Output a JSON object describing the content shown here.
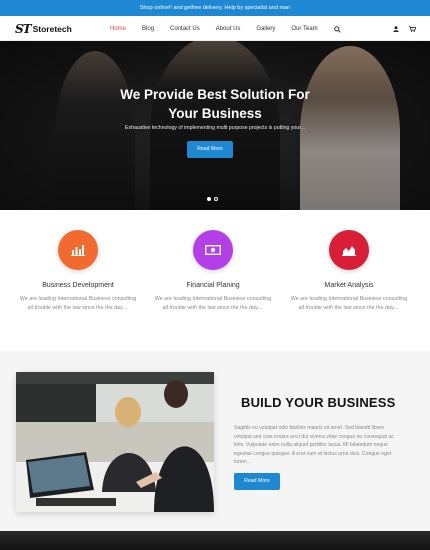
{
  "topbar": {
    "text": "Shop online!! and getfree delivery. Help by specialist and man"
  },
  "brand": {
    "mark": "ST",
    "name": "Storetech"
  },
  "nav": {
    "items": [
      {
        "label": "Home",
        "active": true
      },
      {
        "label": "Blog"
      },
      {
        "label": "Contact Us"
      },
      {
        "label": "About Us"
      },
      {
        "label": "Gallery"
      },
      {
        "label": "Our Team"
      }
    ],
    "icons": [
      "search-icon",
      "user-icon",
      "cart-icon"
    ]
  },
  "hero": {
    "title_line1": "We Provide Best Solution For",
    "title_line2": "Your Business",
    "subtitle": "Exhaustive technology of implementing multi purpose projects is putting your...",
    "button": "Read More",
    "slides": 2,
    "active_slide": 1
  },
  "services": [
    {
      "title": "Business Development",
      "text": "We are leading International Business consulting all trouble with the law since the the day....",
      "color": "#f26a2e",
      "icon": "bar-chart-icon"
    },
    {
      "title": "Financial Planing",
      "text": "We are leading International Business consulting all trouble with the law since the the day....",
      "color": "#b43fe8",
      "icon": "money-icon"
    },
    {
      "title": "Market Analysis",
      "text": "We are leading International Business consulting all trouble with the law since the the day....",
      "color": "#d81f35",
      "icon": "area-chart-icon"
    }
  ],
  "about": {
    "title": "BUILD YOUR BUSINESS",
    "text": "Sagittis eu volutpat odio facilisis mauris sit amet. Sed blandit libero volutpat sed cras ornare arcu dui viverra vitae congue eu consequat ac felis. Vulputate enim nulla aliquet porttitor lacus. Mi bibendum neque egestas congue quisque. A erat nam at lectus urna duis. Congue eget lorem...",
    "button": "Read More"
  },
  "colors": {
    "accent": "#1e88d3",
    "nav_active": "#e64a3c"
  }
}
